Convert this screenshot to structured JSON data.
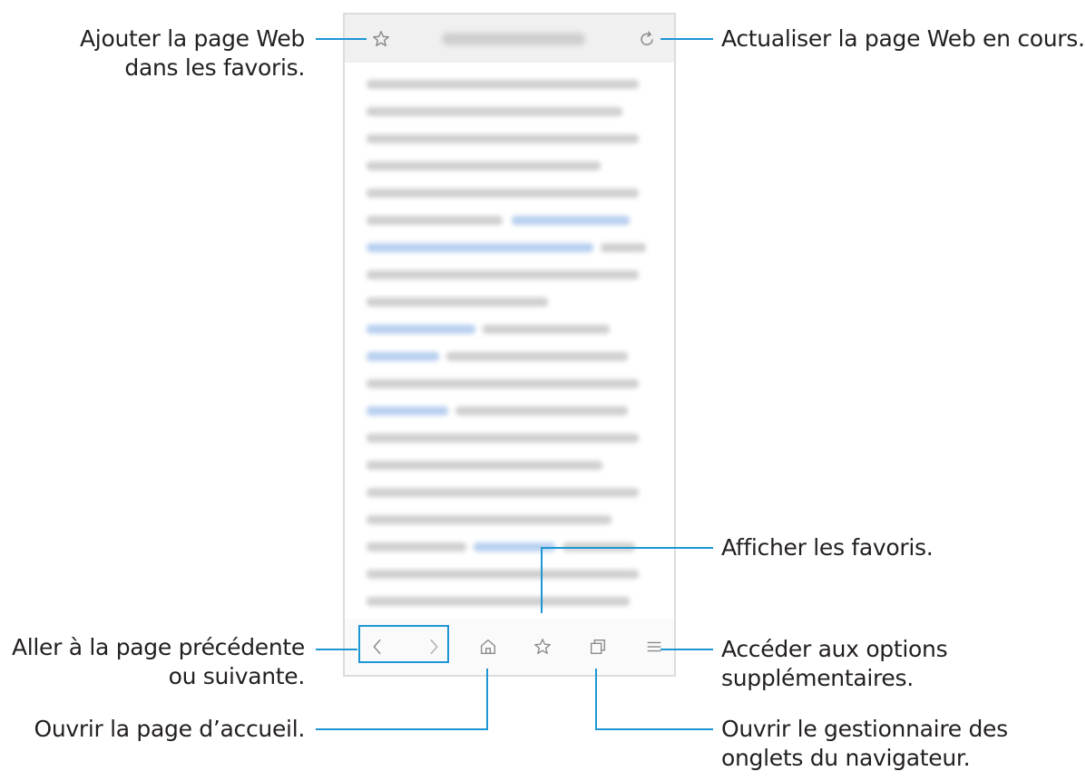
{
  "annotations": {
    "add_bookmark": {
      "line1": "Ajouter la page Web",
      "line2": "dans les favoris."
    },
    "refresh": {
      "line1": "Actualiser la page Web en cours."
    },
    "show_bookmarks": {
      "line1": "Afficher les favoris."
    },
    "back_forward": {
      "line1": "Aller à la page précédente",
      "line2": "ou suivante."
    },
    "more_options": {
      "line1": "Accéder aux options",
      "line2": "supplémentaires."
    },
    "home": {
      "line1": "Ouvrir la page d’accueil."
    },
    "tabs_manager": {
      "line1": "Ouvrir le gestionnaire des",
      "line2": "onglets du navigateur."
    }
  },
  "icons": {
    "top_left": "star-outline-icon",
    "top_right": "refresh-icon",
    "bottom": [
      "back-icon",
      "forward-icon",
      "home-icon",
      "bookmarks-star-icon",
      "tabs-icon",
      "menu-icon"
    ]
  },
  "colors": {
    "callout": "#1d97d4",
    "text": "#231f20",
    "icon": "#8a8a8a"
  }
}
